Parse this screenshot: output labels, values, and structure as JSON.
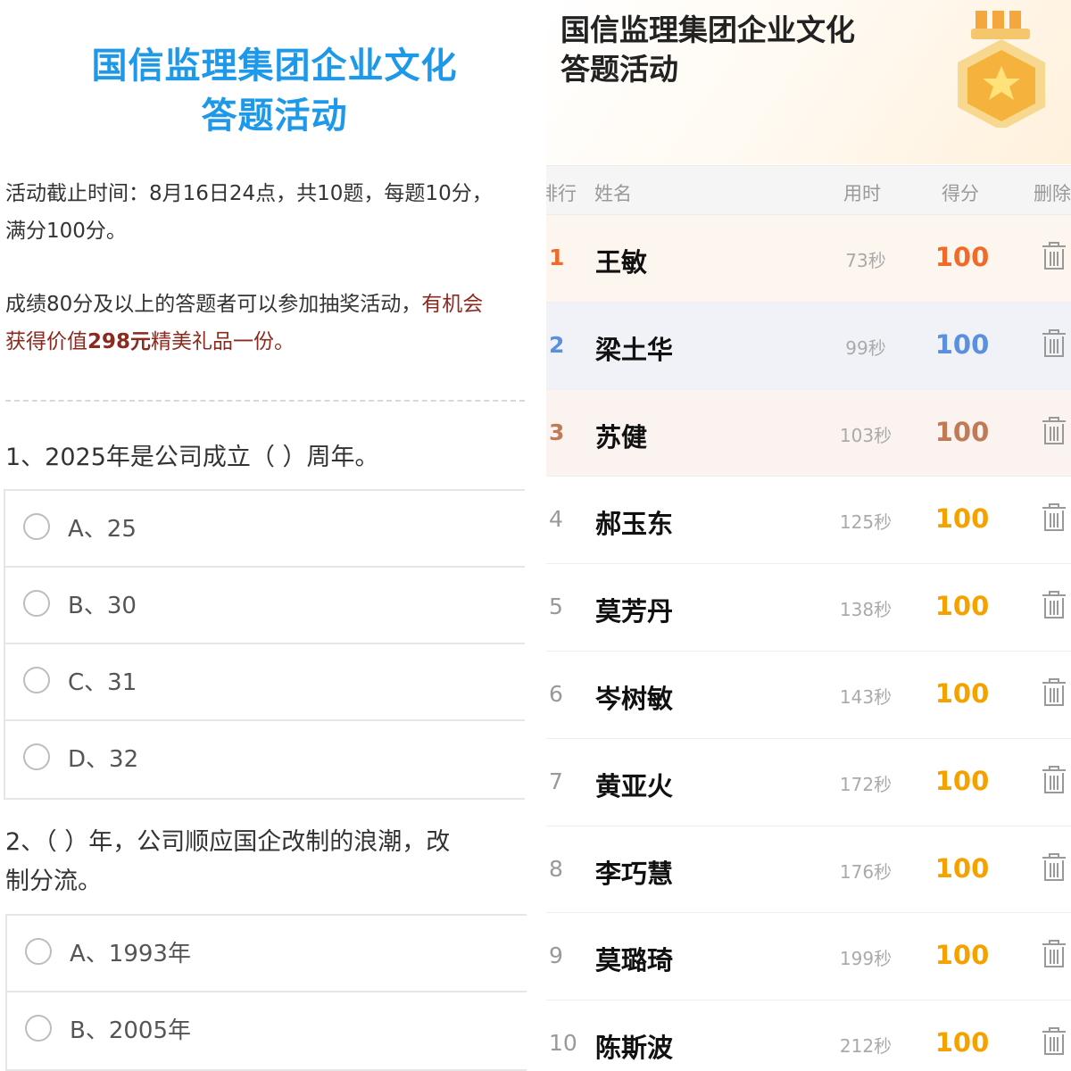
{
  "quiz": {
    "title_line1": "国信监理集团企业文化",
    "title_line2": "答题活动",
    "info_line1": "活动截止时间：8月16日24点，共10题，每题10分，",
    "info_line2": "满分100分。",
    "info_line3_a": "成绩80分及以上的答题者可以参加抽奖活动，",
    "info_line3_b": "有机会",
    "info_line4_a": "获得价值",
    "info_line4_b": "298元",
    "info_line4_c": "精美礼品一份。",
    "questions": [
      {
        "text": "1、2025年是公司成立（    ）周年。",
        "options": [
          "A、25",
          "B、30",
          "C、31",
          "D、32"
        ]
      },
      {
        "text_line1": "2、（    ）年，公司顺应国企改制的浪潮，改",
        "text_line2": "制分流。",
        "options": [
          "A、1993年",
          "B、2005年"
        ]
      }
    ]
  },
  "leaderboard": {
    "title_line1": "国信监理集团企业文化",
    "title_line2": "答题活动",
    "header": {
      "rank": "排行",
      "name": "姓名",
      "time": "用时",
      "score": "得分",
      "delete": "删除"
    },
    "rows": [
      {
        "rank": "1",
        "name": "王敏",
        "time": "73秒",
        "score": "100"
      },
      {
        "rank": "2",
        "name": "梁土华",
        "time": "99秒",
        "score": "100"
      },
      {
        "rank": "3",
        "name": "苏健",
        "time": "103秒",
        "score": "100"
      },
      {
        "rank": "4",
        "name": "郝玉东",
        "time": "125秒",
        "score": "100"
      },
      {
        "rank": "5",
        "name": "莫芳丹",
        "time": "138秒",
        "score": "100"
      },
      {
        "rank": "6",
        "name": "岑树敏",
        "time": "143秒",
        "score": "100"
      },
      {
        "rank": "7",
        "name": "黄亚火",
        "time": "172秒",
        "score": "100"
      },
      {
        "rank": "8",
        "name": "李巧慧",
        "time": "176秒",
        "score": "100"
      },
      {
        "rank": "9",
        "name": "莫璐琦",
        "time": "199秒",
        "score": "100"
      },
      {
        "rank": "10",
        "name": "陈斯波",
        "time": "212秒",
        "score": "100"
      }
    ],
    "row_icon": "trash-icon",
    "banner_icon": "medal-icon"
  },
  "colors": {
    "title_blue": "#1e98e8",
    "highlight_red": "#8b2a1f",
    "score_gold": "#f5a200",
    "rank1": "#f06a2a",
    "rank2": "#5b8fe0",
    "rank3": "#c07a55",
    "rank1_bg": "#fdf6ef",
    "rank2_bg": "#f0f2f7",
    "rank3_bg": "#fbf3ef"
  }
}
